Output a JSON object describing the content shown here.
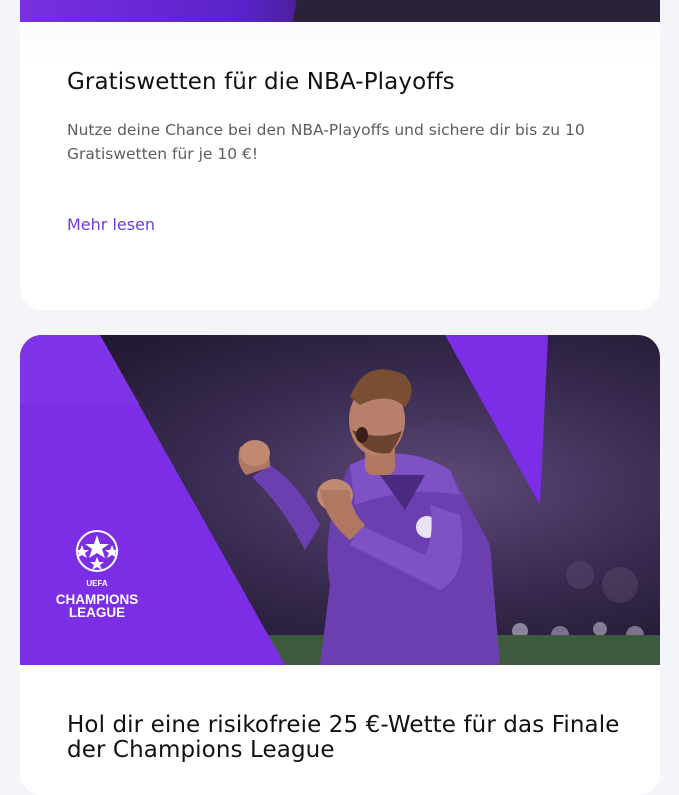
{
  "cards": [
    {
      "title": "Gratiswetten für die NBA-Playoffs",
      "description": "Nutze deine Chance bei den NBA-Playoffs und sichere dir bis zu 10 Gratiswetten für je 10 €!",
      "link_label": "Mehr lesen"
    },
    {
      "logo_text": [
        "UEFA",
        "CHAMPIONS",
        "LEAGUE"
      ],
      "title": "Hol dir eine risikofreie 25 €-Wette für das Finale der Champions League"
    }
  ],
  "colors": {
    "accent": "#6d3fd6",
    "brand_purple": "#7a2fe0",
    "card_bg": "#ffffff",
    "page_bg": "#f4f5f9"
  }
}
